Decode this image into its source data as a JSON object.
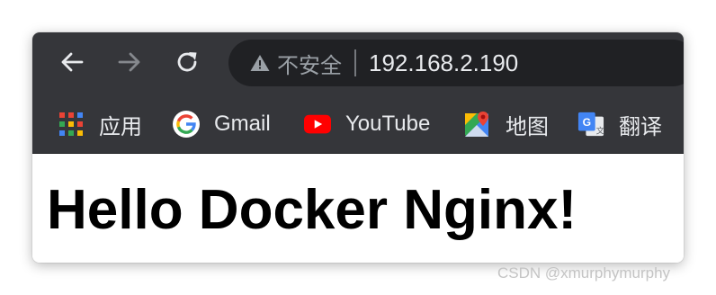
{
  "toolbar": {
    "back_icon": "arrow-left-icon",
    "forward_icon": "arrow-right-icon",
    "reload_icon": "reload-icon",
    "security_icon": "warning-triangle-icon",
    "security_label": "不安全",
    "url": "192.168.2.190"
  },
  "bookmarks": [
    {
      "label": "应用",
      "icon": "apps-grid-icon"
    },
    {
      "label": "Gmail",
      "icon": "google-g-icon"
    },
    {
      "label": "YouTube",
      "icon": "youtube-icon"
    },
    {
      "label": "地图",
      "icon": "maps-icon"
    },
    {
      "label": "翻译",
      "icon": "translate-icon"
    }
  ],
  "page": {
    "heading": "Hello Docker Nginx!"
  },
  "watermark": "CSDN @xmurphymurphy",
  "colors": {
    "toolbar_bg": "#35363a",
    "omnibox_bg": "#202124",
    "text_light": "#e8eaed",
    "text_dim": "#9aa0a6",
    "youtube_red": "#ff0000"
  }
}
